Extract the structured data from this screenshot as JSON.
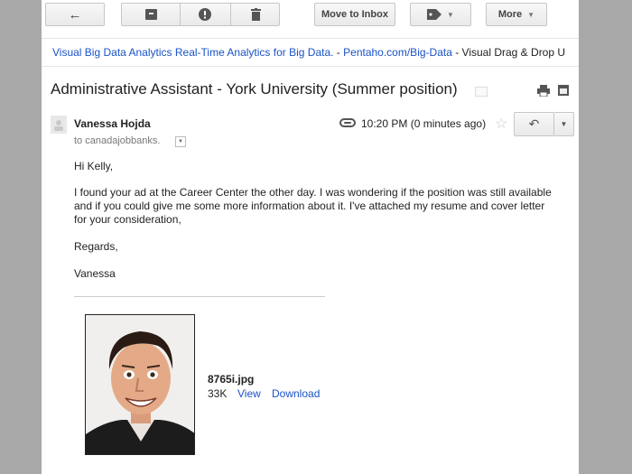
{
  "toolbar": {
    "move_label": "Move to Inbox",
    "more_label": "More"
  },
  "ad": {
    "title": "Visual Big Data Analytics Real-Time Analytics for Big Data.",
    "sep": " - ",
    "domain": "Pentaho.com/Big-Data",
    "tail": " - Visual Drag & Drop U"
  },
  "email": {
    "subject": "Administrative Assistant - York University (Summer position)",
    "sender": "Vanessa Hojda",
    "to": "to canadajobbanks.",
    "time": "10:20 PM (0 minutes ago)",
    "greeting": "Hi Kelly,",
    "body_lines": [
      "I found your ad at the Career Center the other day. I was wondering if the position was still available",
      "and if you could give me some more information about it. I've attached my resume and cover letter",
      "for your consideration,"
    ],
    "closing": "Regards,",
    "signature": "Vanessa"
  },
  "attachment": {
    "filename": "8765i.jpg",
    "size": "33K",
    "view_label": "View",
    "download_label": "Download"
  },
  "icons": [
    "back-arrow-icon",
    "archive-icon",
    "spam-icon",
    "trash-icon",
    "label-icon",
    "print-icon",
    "new-window-icon",
    "paperclip-icon",
    "star-icon",
    "reply-icon",
    "chevron-down-icon",
    "avatar-icon"
  ]
}
